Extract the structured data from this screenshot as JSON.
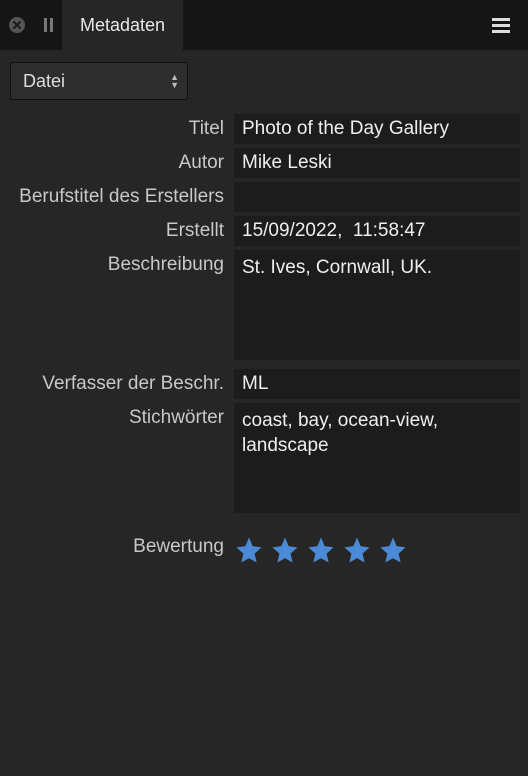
{
  "tab": {
    "title": "Metadaten"
  },
  "toolbar": {
    "dropdown_label": "Datei"
  },
  "labels": {
    "title": "Titel",
    "author": "Autor",
    "creator_job_title": "Berufstitel des Erstellers",
    "created": "Erstellt",
    "description": "Beschreibung",
    "description_writer": "Verfasser der Beschr.",
    "keywords": "Stichwörter",
    "rating": "Bewertung"
  },
  "values": {
    "title": "Photo of the Day Gallery",
    "author": "Mike Leski",
    "creator_job_title": "",
    "created": "15/09/2022,  11:58:47",
    "description": "St. Ives, Cornwall, UK.",
    "description_writer": "ML",
    "keywords": "coast, bay, ocean-view, landscape"
  },
  "rating": {
    "value": 5,
    "max": 5
  }
}
